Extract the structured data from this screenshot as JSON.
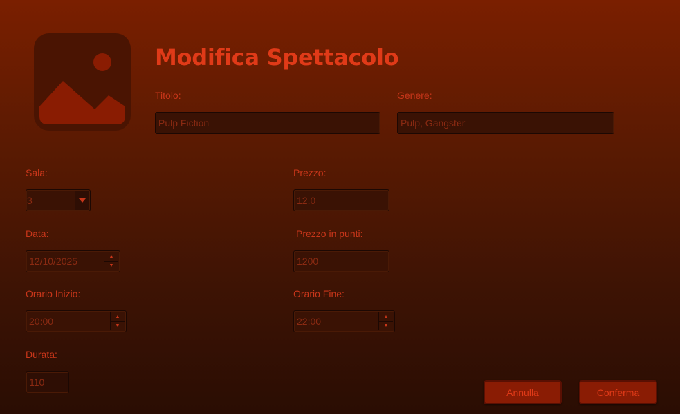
{
  "header": {
    "title": "Modifica Spettacolo",
    "image_icon": "image-placeholder-icon"
  },
  "form": {
    "titolo": {
      "label": "Titolo:",
      "value": "Pulp Fiction"
    },
    "genere": {
      "label": "Genere:",
      "value": "Pulp, Gangster"
    },
    "sala": {
      "label": "Sala:",
      "value": "3"
    },
    "prezzo": {
      "label": "Prezzo:",
      "value": "12.0"
    },
    "data": {
      "label": "Data:",
      "value": "12/10/2025"
    },
    "prezzo_punti": {
      "label": "Prezzo in punti:",
      "value": "1200"
    },
    "orario_inizio": {
      "label": "Orario Inizio:",
      "value": "20:00"
    },
    "orario_fine": {
      "label": "Orario Fine:",
      "value": "22:00"
    },
    "durata": {
      "label": "Durata:",
      "value": "110"
    }
  },
  "actions": {
    "annulla": "Annulla",
    "conferma": "Conferma"
  },
  "colors": {
    "accent": "#e03a18",
    "label": "#c8361a",
    "field_bg": "#3a1204",
    "button_bg": "#8a1c04"
  }
}
